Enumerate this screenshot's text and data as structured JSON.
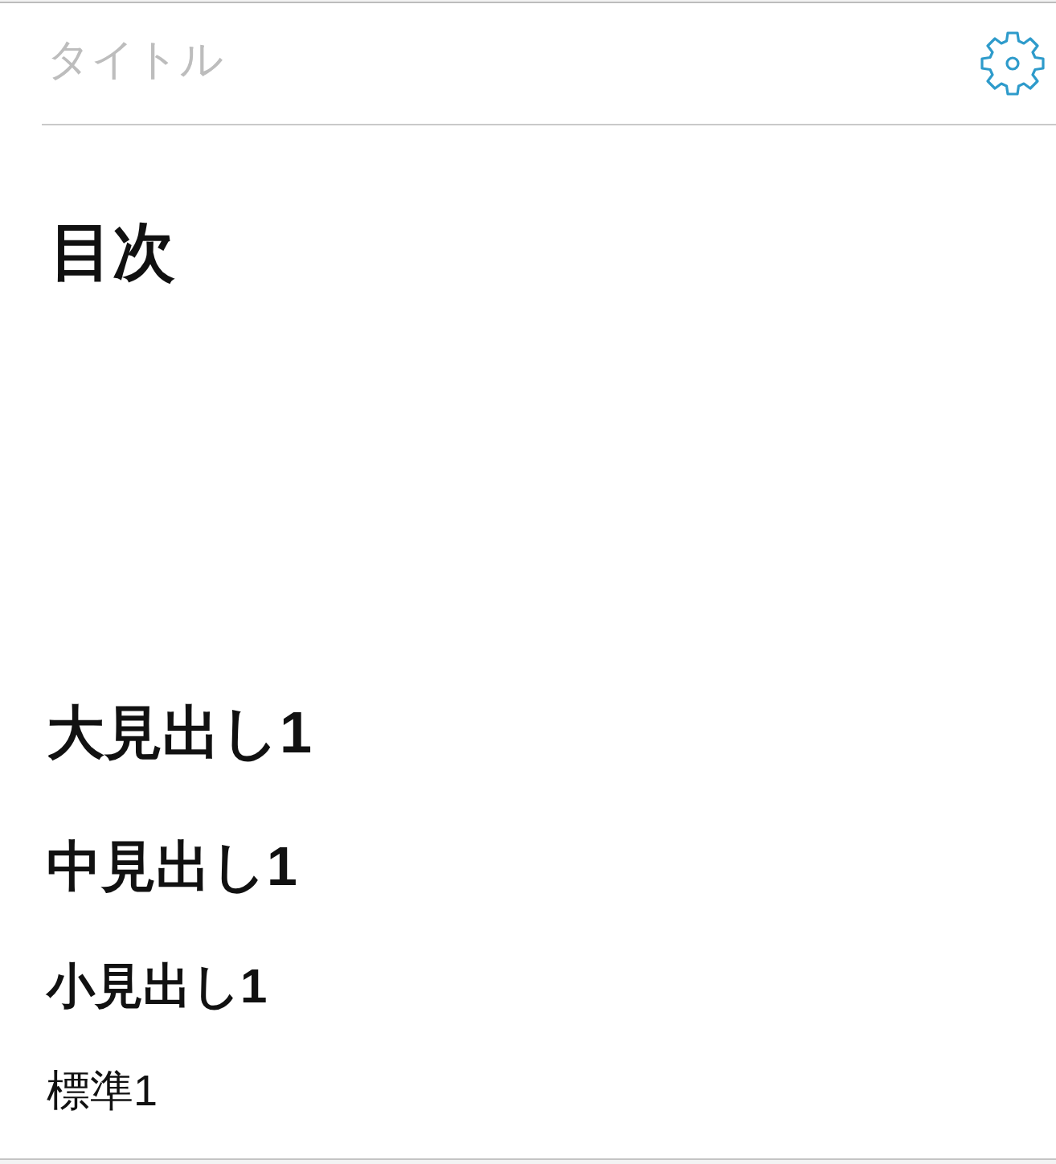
{
  "title_field": {
    "placeholder": "タイトル"
  },
  "toc": {
    "heading": "目次"
  },
  "blocks": [
    {
      "kind": "h1",
      "text": "大見出し1"
    },
    {
      "kind": "h2",
      "text": "中見出し1"
    },
    {
      "kind": "h3",
      "text": "小見出し1"
    },
    {
      "kind": "p",
      "text": "標準1"
    }
  ]
}
